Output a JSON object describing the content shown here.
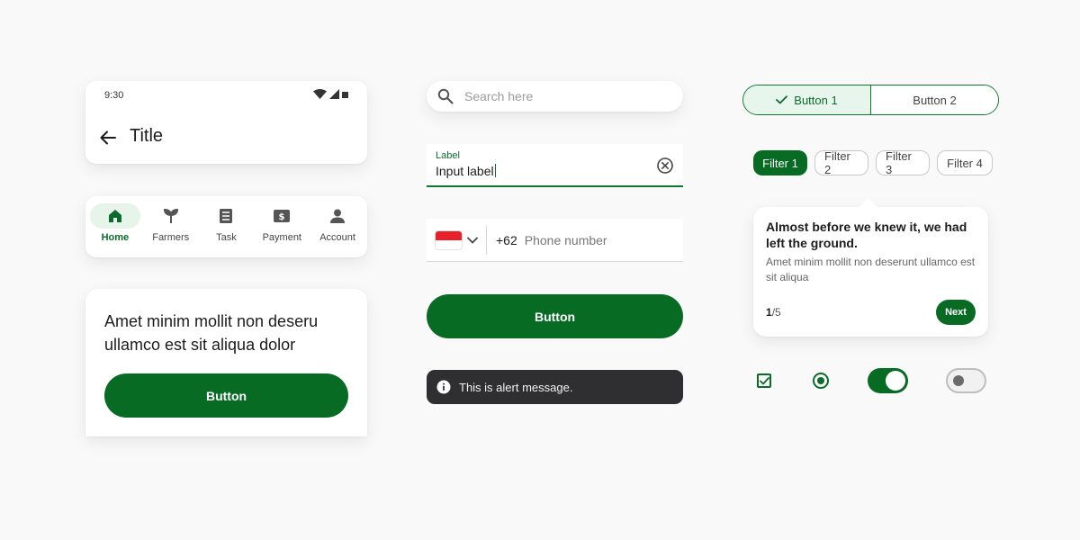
{
  "app_bar": {
    "time": "9:30",
    "title": "Title",
    "icons": [
      "wifi-icon",
      "signal-icon",
      "battery-icon",
      "back-arrow-icon"
    ]
  },
  "bottom_nav": {
    "items": [
      {
        "label": "Home",
        "icon": "home-icon",
        "active": true
      },
      {
        "label": "Farmers",
        "icon": "sprout-icon",
        "active": false
      },
      {
        "label": "Task",
        "icon": "task-list-icon",
        "active": false
      },
      {
        "label": "Payment",
        "icon": "payment-icon",
        "active": false
      },
      {
        "label": "Account",
        "icon": "account-icon",
        "active": false
      }
    ]
  },
  "content_card": {
    "heading": "Amet minim mollit non deseru ullamco est sit aliqua dolor",
    "button_label": "Button"
  },
  "search": {
    "placeholder": "Search here"
  },
  "text_field": {
    "label": "Label",
    "value": "Input label"
  },
  "phone_field": {
    "country_code": "+62",
    "placeholder": "Phone number",
    "flag": "indonesia-flag"
  },
  "primary_button": {
    "label": "Button"
  },
  "alert": {
    "message": "This is alert message."
  },
  "segmented": {
    "items": [
      {
        "label": "Button 1",
        "selected": true
      },
      {
        "label": "Button 2",
        "selected": false
      }
    ]
  },
  "filters": {
    "items": [
      {
        "label": "Filter 1",
        "selected": true
      },
      {
        "label": "Filter 2",
        "selected": false
      },
      {
        "label": "Filter 3",
        "selected": false
      },
      {
        "label": "Filter 4",
        "selected": false
      }
    ]
  },
  "tooltip": {
    "title": "Almost before we knew it, we had left the ground.",
    "body": "Amet minim mollit non deserunt ullamco est sit aliqua",
    "page_current": "1",
    "page_total": "/5",
    "next_label": "Next"
  },
  "controls": {
    "checkbox_checked": true,
    "radio_selected": true,
    "switch_1_on": true,
    "switch_2_on": false
  },
  "colors": {
    "primary": "#076b24",
    "primary_light": "#e6f4ea",
    "alert_bg": "#2f2f31",
    "background": "#f9f9f9"
  }
}
